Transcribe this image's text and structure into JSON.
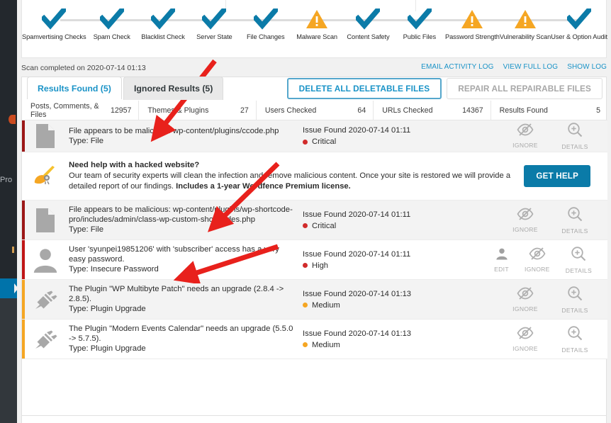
{
  "sidebar": {
    "partial_label": "Pro"
  },
  "scan": {
    "stages": [
      {
        "label": "Spamvertising Checks",
        "state": "ok"
      },
      {
        "label": "Spam Check",
        "state": "ok"
      },
      {
        "label": "Blacklist Check",
        "state": "ok"
      },
      {
        "label": "Server State",
        "state": "ok"
      },
      {
        "label": "File Changes",
        "state": "ok"
      },
      {
        "label": "Malware Scan",
        "state": "warn"
      },
      {
        "label": "Content Safety",
        "state": "ok"
      },
      {
        "label": "Public Files",
        "state": "ok"
      },
      {
        "label": "Password Strength",
        "state": "warn"
      },
      {
        "label": "Vulnerability Scan",
        "state": "warn"
      },
      {
        "label": "User & Option Audit",
        "state": "ok"
      }
    ],
    "completed_text": "Scan completed on 2020-07-14 01:13",
    "log_links": [
      {
        "label": "EMAIL ACTIVITY LOG"
      },
      {
        "label": "VIEW FULL LOG"
      },
      {
        "label": "SHOW LOG"
      }
    ]
  },
  "tabs": [
    {
      "label": "Results Found (5)",
      "active": true
    },
    {
      "label": "Ignored Results (5)",
      "active": false
    }
  ],
  "action_buttons": [
    {
      "label": "DELETE ALL DELETABLE FILES",
      "style": "primary"
    },
    {
      "label": "REPAIR ALL REPAIRABLE FILES",
      "style": "muted"
    }
  ],
  "stats": [
    {
      "label": "Posts, Comments, & Files",
      "value": "12957"
    },
    {
      "label": "Themes & Plugins",
      "value": "27"
    },
    {
      "label": "Users Checked",
      "value": "64"
    },
    {
      "label": "URLs Checked",
      "value": "14367"
    },
    {
      "label": "Results Found",
      "value": "5"
    }
  ],
  "colors": {
    "accent_blue": "#1a93c7",
    "wp_blue": "#0073aa",
    "ok_check": "#0b7ba8",
    "warn_amber": "#f5a623",
    "critical_red": "#d12b2b",
    "critical_bar": "#9c1717",
    "medium_bar": "#f5a623",
    "promo_button": "#0b7ba8"
  },
  "rows": [
    {
      "icon": "file-icon",
      "title": "File appears to be malicious: wp-content/plugins/ccode.php",
      "type": "Type: File",
      "found": "Issue Found 2020-07-14 01:11",
      "severity": "Critical",
      "severity_color": "#d12b2b",
      "bar_color": "#9c1717",
      "background": "grey",
      "actions": [
        {
          "label": "IGNORE",
          "icon": "eye-slash-icon"
        },
        {
          "label": "DETAILS",
          "icon": "magnify-plus-icon"
        }
      ]
    },
    {
      "icon": "file-icon",
      "title": "File appears to be malicious: wp-content/plugins/wp-shortcode-pro/includes/admin/class-wp-custom-shortcodes.php",
      "type": "Type: File",
      "found": "Issue Found 2020-07-14 01:11",
      "severity": "Critical",
      "severity_color": "#d12b2b",
      "bar_color": "#9c1717",
      "background": "grey",
      "actions": [
        {
          "label": "IGNORE",
          "icon": "eye-slash-icon"
        },
        {
          "label": "DETAILS",
          "icon": "magnify-plus-icon"
        }
      ]
    },
    {
      "icon": "user-icon",
      "title": "User 'syunpei19851206' with 'subscriber' access has a very easy password.",
      "type": "Type: Insecure Password",
      "found": "Issue Found 2020-07-14 01:11",
      "severity": "High",
      "severity_color": "#d12b2b",
      "bar_color": "#c01616",
      "background": "white",
      "actions": [
        {
          "label": "EDIT",
          "icon": "user-icon"
        },
        {
          "label": "IGNORE",
          "icon": "eye-slash-icon"
        },
        {
          "label": "DETAILS",
          "icon": "magnify-plus-icon"
        }
      ]
    },
    {
      "icon": "plug-icon",
      "title": "The Plugin \"WP Multibyte Patch\" needs an upgrade (2.8.4 -> 2.8.5).",
      "type": "Type: Plugin Upgrade",
      "found": "Issue Found 2020-07-14 01:13",
      "severity": "Medium",
      "severity_color": "#f5a623",
      "bar_color": "#f5a623",
      "background": "grey",
      "actions": [
        {
          "label": "IGNORE",
          "icon": "eye-slash-icon"
        },
        {
          "label": "DETAILS",
          "icon": "magnify-plus-icon"
        }
      ]
    },
    {
      "icon": "plug-icon",
      "title": "The Plugin \"Modern Events Calendar\" needs an upgrade (5.5.0 -> 5.7.5).",
      "type": "Type: Plugin Upgrade",
      "found": "Issue Found 2020-07-14 01:13",
      "severity": "Medium",
      "severity_color": "#f5a623",
      "bar_color": "#f5a623",
      "background": "white",
      "actions": [
        {
          "label": "IGNORE",
          "icon": "eye-slash-icon"
        },
        {
          "label": "DETAILS",
          "icon": "magnify-plus-icon"
        }
      ]
    }
  ],
  "promo": {
    "icon": "broom-icon",
    "heading": "Need help with a hacked website?",
    "body_1": "Our team of security experts will clean the infection and remove malicious content. Once your site is restored we will provide a detailed report of our findings. ",
    "body_bold": "Includes a 1-year Wordfence Premium license.",
    "button_label": "GET HELP"
  }
}
